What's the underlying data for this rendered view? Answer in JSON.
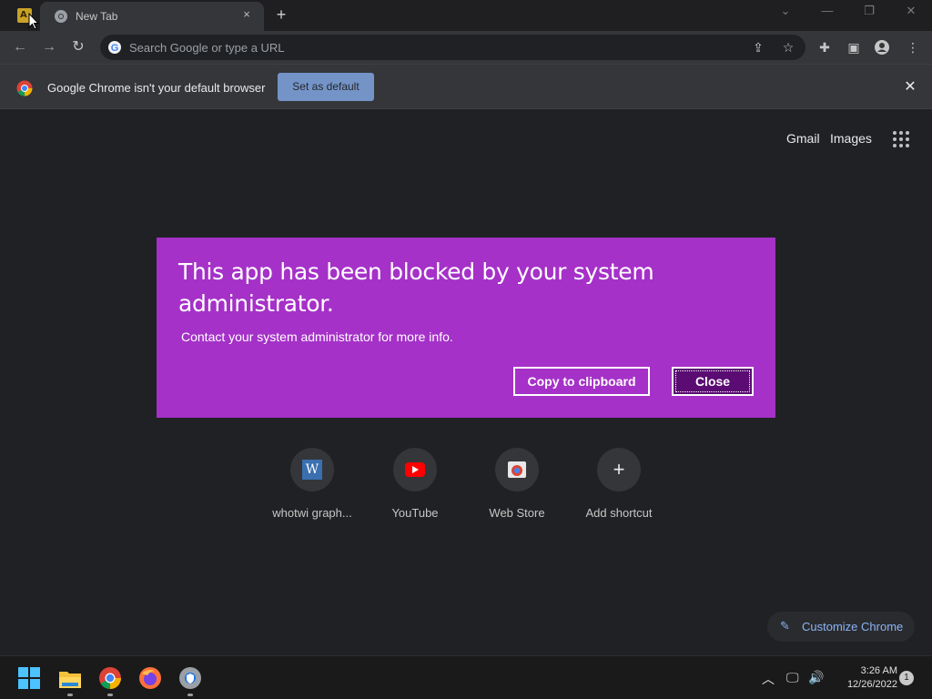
{
  "titlebar": {
    "app_badge": "A",
    "tab_title": "New Tab",
    "tab_close": "×",
    "new_tab": "+",
    "controls": [
      "⌄",
      "—",
      "❐",
      "✕"
    ]
  },
  "toolbar": {
    "back": "←",
    "forward": "→",
    "reload": "↻",
    "omnibox_placeholder": "Search Google or type a URL"
  },
  "infobar": {
    "message": "Google Chrome isn't your default browser",
    "button": "Set as default",
    "close": "✕"
  },
  "ntp": {
    "links": [
      "Gmail",
      "Images"
    ],
    "shortcuts": [
      {
        "label": "whotwi graph...",
        "icon": "w-icon"
      },
      {
        "label": "YouTube",
        "icon": "youtube-icon"
      },
      {
        "label": "Web Store",
        "icon": "webstore-icon"
      },
      {
        "label": "Add shortcut",
        "icon": "plus-icon"
      }
    ],
    "customize": "Customize Chrome"
  },
  "dialog": {
    "heading": "This app has been blocked by your system administrator.",
    "message": "Contact your system administrator for more info.",
    "copy_button": "Copy to clipboard",
    "close_button": "Close",
    "bg_color": "#a531c8"
  },
  "taskbar": {
    "time": "3:26 AM",
    "date": "12/26/2022",
    "notifications": "1"
  }
}
